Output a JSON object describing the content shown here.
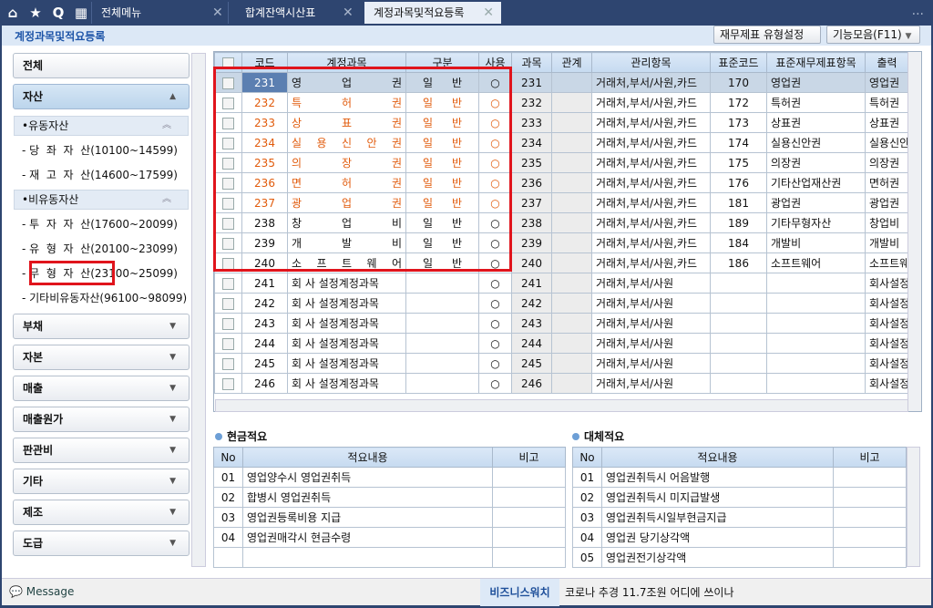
{
  "tabs": {
    "menu": "전체메뉴",
    "trial": "합계잔액시산표",
    "active": "계정과목및적요등록",
    "close": "✕",
    "more": "..."
  },
  "page": {
    "title": "계정과목및적요등록",
    "btn_type": "재무제표 유형설정",
    "btn_func": "기능모음(F11)"
  },
  "left": {
    "all": "전체",
    "asset": "자산",
    "current": "•유동자산",
    "cur_items": [
      "- 당  좌  자  산(10100~14599)",
      "- 재  고  자  산(14600~17599)"
    ],
    "noncurrent": "•비유동자산",
    "non_items": [
      "- 투  자  자  산(17600~20099)",
      "- 유  형  자  산(20100~23099)",
      "- 무  형  자  산(23100~25099)",
      "- 기타비유동자산(96100~98099)"
    ],
    "cats": [
      "부채",
      "자본",
      "매출",
      "매출원가",
      "판관비",
      "기타",
      "제조",
      "도급"
    ]
  },
  "grid": {
    "headers": [
      "",
      "코드",
      "계정과목",
      "구분",
      "사용",
      "과목",
      "관계",
      "관리항목",
      "표준코드",
      "표준재무제표항목",
      "출력"
    ],
    "rows": [
      [
        "231",
        "영 업 권",
        "일 반",
        "○",
        "231",
        "",
        "거래처,부서/사원,카드",
        "170",
        "영업권",
        "영업권"
      ],
      [
        "232",
        "특 허 권",
        "일 반",
        "○",
        "232",
        "",
        "거래처,부서/사원,카드",
        "172",
        "특허권",
        "특허권"
      ],
      [
        "233",
        "상 표 권",
        "일 반",
        "○",
        "233",
        "",
        "거래처,부서/사원,카드",
        "173",
        "상표권",
        "상표권"
      ],
      [
        "234",
        "실 용 신 안 권",
        "일 반",
        "○",
        "234",
        "",
        "거래처,부서/사원,카드",
        "174",
        "실용신안권",
        "실용신안"
      ],
      [
        "235",
        "의 장 권",
        "일 반",
        "○",
        "235",
        "",
        "거래처,부서/사원,카드",
        "175",
        "의장권",
        "의장권"
      ],
      [
        "236",
        "면 허 권",
        "일 반",
        "○",
        "236",
        "",
        "거래처,부서/사원,카드",
        "176",
        "기타산업재산권",
        "면허권"
      ],
      [
        "237",
        "광 업 권",
        "일 반",
        "○",
        "237",
        "",
        "거래처,부서/사원,카드",
        "181",
        "광업권",
        "광업권"
      ],
      [
        "238",
        "창 업 비",
        "일 반",
        "○",
        "238",
        "",
        "거래처,부서/사원,카드",
        "189",
        "기타무형자산",
        "창업비"
      ],
      [
        "239",
        "개 발 비",
        "일 반",
        "○",
        "239",
        "",
        "거래처,부서/사원,카드",
        "184",
        "개발비",
        "개발비"
      ],
      [
        "240",
        "소 프 트 웨 어",
        "일 반",
        "○",
        "240",
        "",
        "거래처,부서/사원,카드",
        "186",
        "소프트웨어",
        "소프트웨"
      ],
      [
        "241",
        "회 사 설정계정과목",
        "",
        "○",
        "241",
        "",
        "거래처,부서/사원",
        "",
        "",
        "회사설정"
      ],
      [
        "242",
        "회 사 설정계정과목",
        "",
        "○",
        "242",
        "",
        "거래처,부서/사원",
        "",
        "",
        "회사설정"
      ],
      [
        "243",
        "회 사 설정계정과목",
        "",
        "○",
        "243",
        "",
        "거래처,부서/사원",
        "",
        "",
        "회사설정"
      ],
      [
        "244",
        "회 사 설정계정과목",
        "",
        "○",
        "244",
        "",
        "거래처,부서/사원",
        "",
        "",
        "회사설정"
      ],
      [
        "245",
        "회 사 설정계정과목",
        "",
        "○",
        "245",
        "",
        "거래처,부서/사원",
        "",
        "",
        "회사설정"
      ],
      [
        "246",
        "회 사 설정계정과목",
        "",
        "○",
        "246",
        "",
        "거래처,부서/사원",
        "",
        "",
        "회사설정"
      ]
    ],
    "orange_codes": [
      "232",
      "233",
      "234",
      "235",
      "236",
      "237"
    ]
  },
  "cash": {
    "title": "현금적요",
    "headers": [
      "No",
      "적요내용",
      "비고"
    ],
    "rows": [
      [
        "01",
        "영업양수시 영업권취득",
        ""
      ],
      [
        "02",
        "합병시 영업권취득",
        ""
      ],
      [
        "03",
        "영업권등록비용 지급",
        ""
      ],
      [
        "04",
        "영업권매각시 현금수령",
        ""
      ],
      [
        "",
        "",
        ""
      ]
    ]
  },
  "transfer": {
    "title": "대체적요",
    "headers": [
      "No",
      "적요내용",
      "비고"
    ],
    "rows": [
      [
        "01",
        "영업권취득시 어음발행",
        ""
      ],
      [
        "02",
        "영업권취득시 미지급발생",
        ""
      ],
      [
        "03",
        "영업권취득시일부현금지급",
        ""
      ],
      [
        "04",
        "영업권 당기상각액",
        ""
      ],
      [
        "05",
        "영업권전기상각액",
        ""
      ]
    ]
  },
  "status": {
    "message": "Message",
    "bw": "비즈니스워치",
    "news": "코로나 추경 11.7조원 어디에 쓰이나"
  },
  "colors": {
    "accent": "#1e55a8",
    "orange": "#e15b0c",
    "highlight": "#e0141c"
  }
}
